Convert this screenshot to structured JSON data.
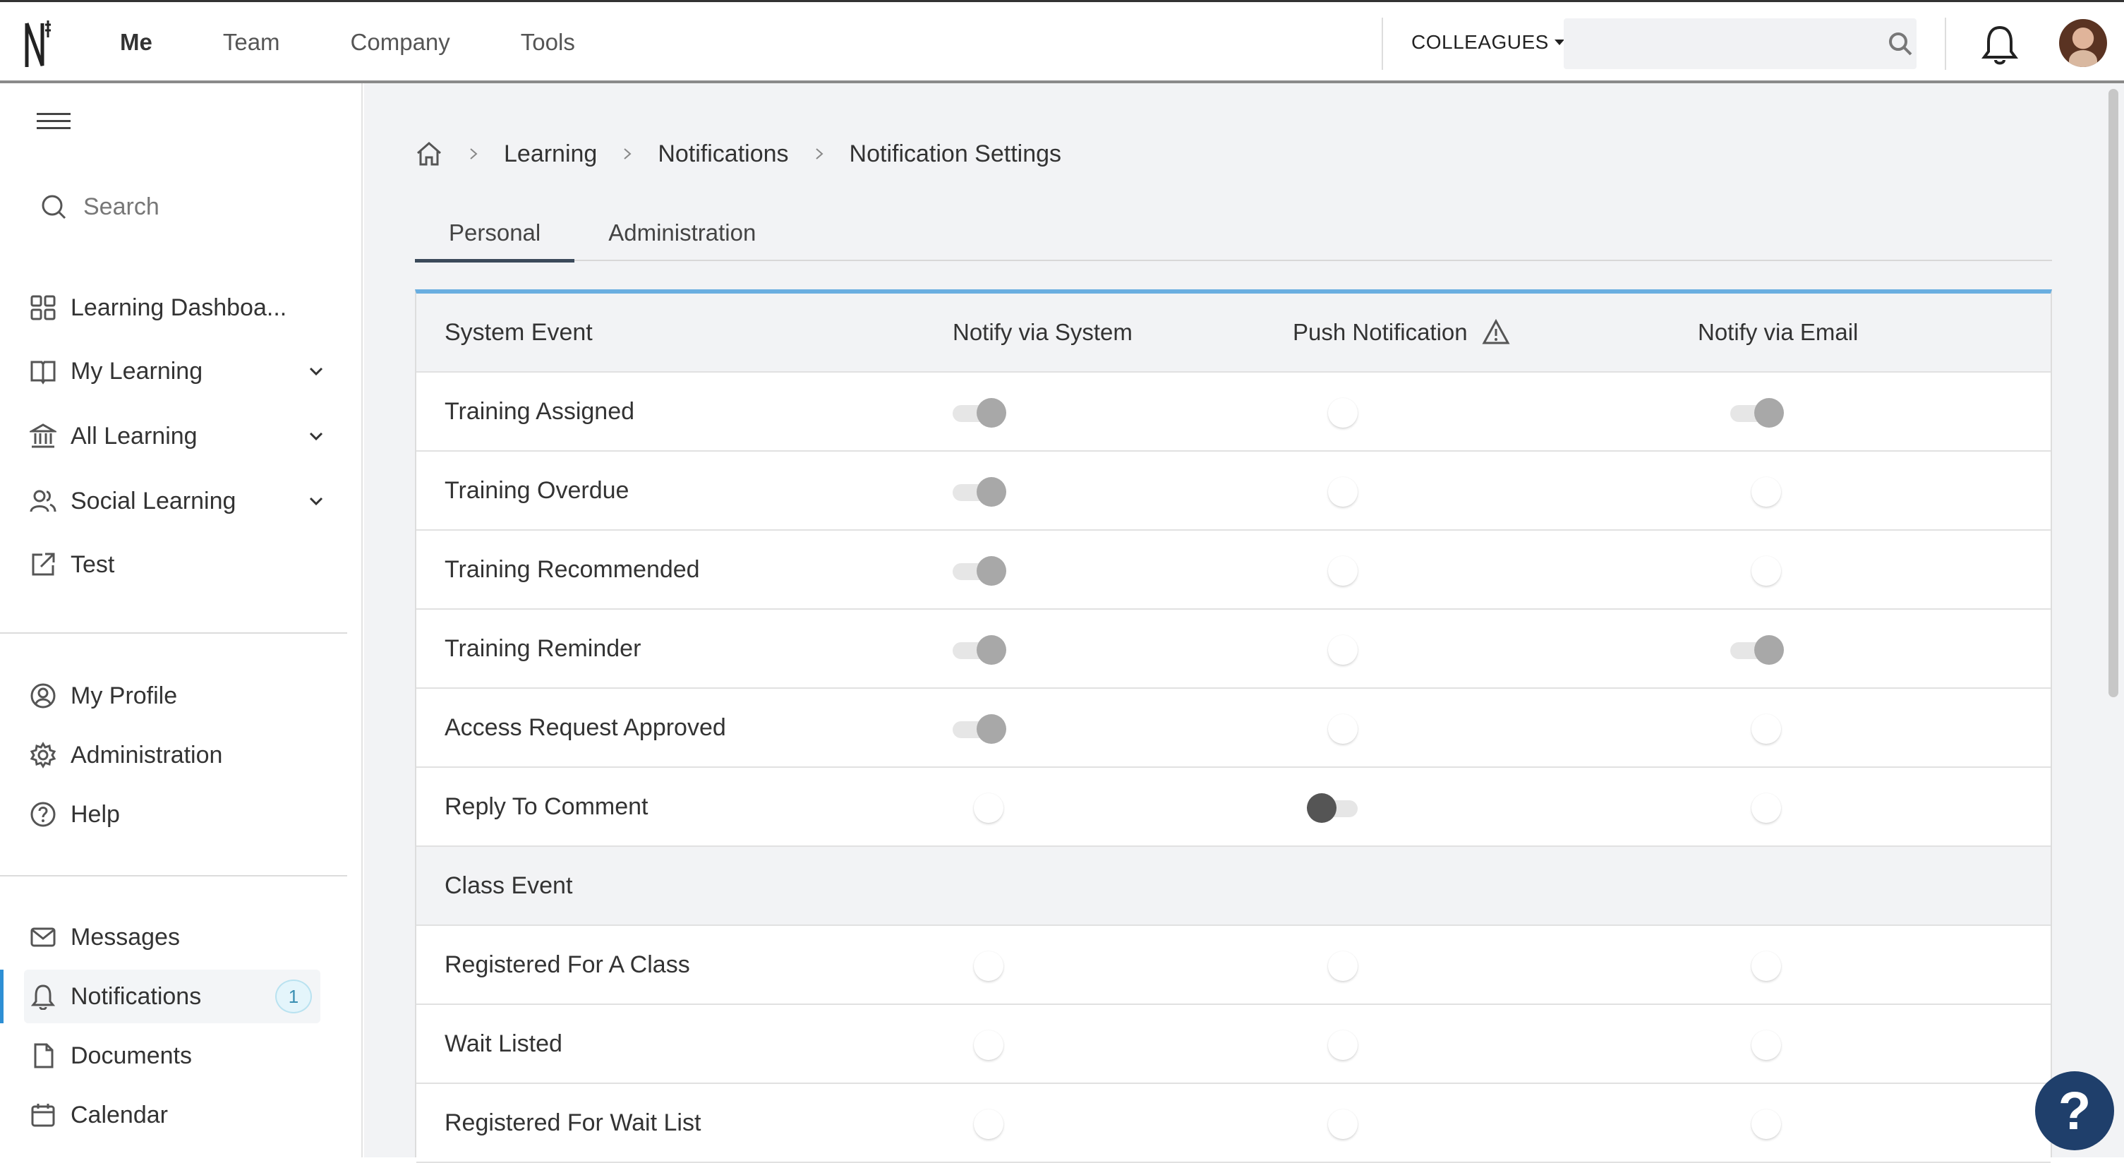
{
  "topbar": {
    "nav": [
      "Me",
      "Team",
      "Company",
      "Tools"
    ],
    "colleagues_label": "COLLEAGUES",
    "search_placeholder": ""
  },
  "sidebar": {
    "search_label": "Search",
    "primary": [
      {
        "label": "Learning Dashboa...",
        "icon": "grid-icon",
        "expandable": false
      },
      {
        "label": "My Learning",
        "icon": "book-icon",
        "expandable": true
      },
      {
        "label": "All Learning",
        "icon": "institution-icon",
        "expandable": true
      },
      {
        "label": "Social Learning",
        "icon": "users-icon",
        "expandable": true
      },
      {
        "label": "Test",
        "icon": "external-link-icon",
        "expandable": false
      }
    ],
    "secondary": [
      {
        "label": "My Profile",
        "icon": "profile-icon"
      },
      {
        "label": "Administration",
        "icon": "gear-icon"
      },
      {
        "label": "Help",
        "icon": "help-circle-icon"
      }
    ],
    "tertiary": [
      {
        "label": "Messages",
        "icon": "mail-icon"
      },
      {
        "label": "Notifications",
        "icon": "bell-icon",
        "badge": "1",
        "active": true
      },
      {
        "label": "Documents",
        "icon": "document-icon"
      },
      {
        "label": "Calendar",
        "icon": "calendar-icon"
      }
    ]
  },
  "breadcrumb": [
    "Learning",
    "Notifications",
    "Notification Settings"
  ],
  "tabs": [
    "Personal",
    "Administration"
  ],
  "table": {
    "columns": [
      "System Event",
      "Notify via System",
      "Push Notification",
      "Notify via Email"
    ],
    "rows": [
      {
        "label": "Training Assigned",
        "system": "on",
        "push": "off",
        "email": "on"
      },
      {
        "label": "Training Overdue",
        "system": "on",
        "push": "off",
        "email": "off"
      },
      {
        "label": "Training Recommended",
        "system": "on",
        "push": "off",
        "email": "off"
      },
      {
        "label": "Training Reminder",
        "system": "on",
        "push": "off",
        "email": "on"
      },
      {
        "label": "Access Request Approved",
        "system": "on",
        "push": "off",
        "email": "off"
      },
      {
        "label": "Reply To Comment",
        "system": "off",
        "push": "dark",
        "email": "off"
      }
    ],
    "section": "Class Event",
    "class_rows": [
      {
        "label": "Registered For A Class",
        "system": "off",
        "push": "off",
        "email": "off"
      },
      {
        "label": "Wait Listed",
        "system": "off",
        "push": "off",
        "email": "off"
      },
      {
        "label": "Registered For Wait List",
        "system": "off",
        "push": "off",
        "email": "off"
      }
    ]
  },
  "help_fab": "?",
  "colors": {
    "accent": "#6aaee0",
    "active_bar": "#2e8fd4",
    "fab": "#1f3f6b"
  }
}
